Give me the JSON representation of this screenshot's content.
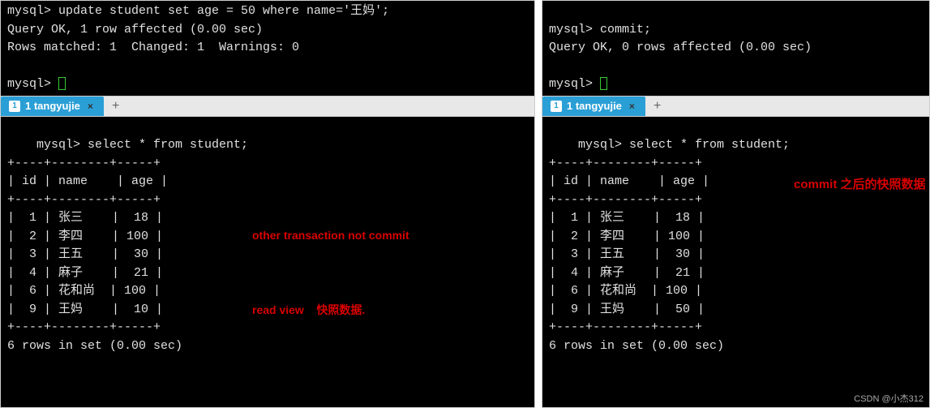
{
  "left": {
    "top_terminal": "mysql> update student set age = 50 where name='王妈';\nQuery OK, 1 row affected (0.00 sec)\nRows matched: 1  Changed: 1  Warnings: 0\n\nmysql> ",
    "tab_label": "1 tangyujie",
    "tab_close": "×",
    "tab_add": "+",
    "bottom_terminal": "mysql> select * from student;\n+----+--------+-----+\n| id | name    | age |\n+----+--------+-----+\n|  1 | 张三    |  18 |\n|  2 | 李四    | 100 |\n|  3 | 王五    |  30 |\n|  4 | 麻子    |  21 |\n|  6 | 花和尚  | 100 |\n|  9 | 王妈    |  10 |\n+----+--------+-----+\n6 rows in set (0.00 sec)",
    "annotation_line1": "other transaction not commit",
    "annotation_line2": "read view    快照数据."
  },
  "right": {
    "top_terminal": "\nmysql> commit;\nQuery OK, 0 rows affected (0.00 sec)\n\nmysql> ",
    "tab_label": "1 tangyujie",
    "tab_close": "×",
    "tab_add": "+",
    "bottom_terminal": "mysql> select * from student;\n+----+--------+-----+\n| id | name    | age |\n+----+--------+-----+\n|  1 | 张三    |  18 |\n|  2 | 李四    | 100 |\n|  3 | 王五    |  30 |\n|  4 | 麻子    |  21 |\n|  6 | 花和尚  | 100 |\n|  9 | 王妈    |  50 |\n+----+--------+-----+\n6 rows in set (0.00 sec)",
    "annotation": "commit 之后的快照数据"
  },
  "watermark": "CSDN @小杰312",
  "chart_data": {
    "type": "table",
    "tables": [
      {
        "title": "student (before commit / read view)",
        "columns": [
          "id",
          "name",
          "age"
        ],
        "rows": [
          [
            1,
            "张三",
            18
          ],
          [
            2,
            "李四",
            100
          ],
          [
            3,
            "王五",
            30
          ],
          [
            4,
            "麻子",
            21
          ],
          [
            6,
            "花和尚",
            100
          ],
          [
            9,
            "王妈",
            10
          ]
        ]
      },
      {
        "title": "student (after commit)",
        "columns": [
          "id",
          "name",
          "age"
        ],
        "rows": [
          [
            1,
            "张三",
            18
          ],
          [
            2,
            "李四",
            100
          ],
          [
            3,
            "王五",
            30
          ],
          [
            4,
            "麻子",
            21
          ],
          [
            6,
            "花和尚",
            100
          ],
          [
            9,
            "王妈",
            50
          ]
        ]
      }
    ]
  }
}
